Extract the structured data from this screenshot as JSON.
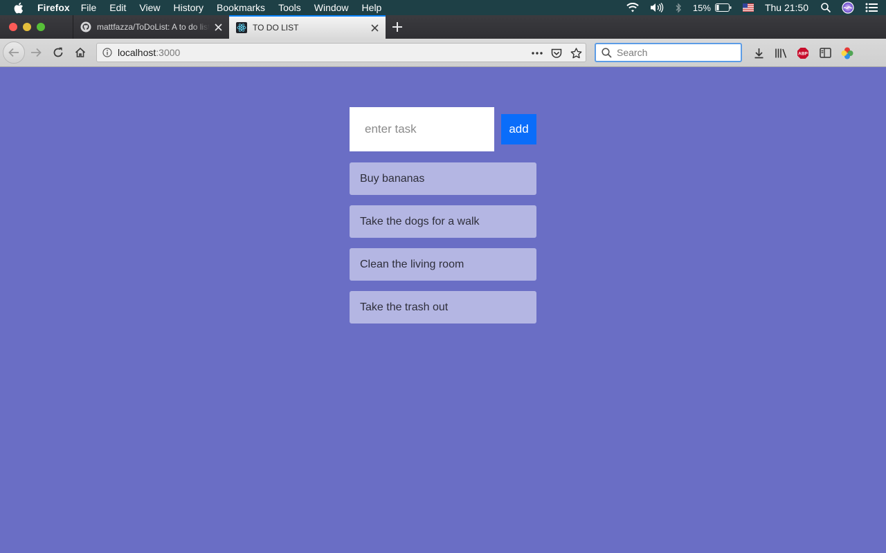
{
  "menubar": {
    "app_name": "Firefox",
    "items": [
      "File",
      "Edit",
      "View",
      "History",
      "Bookmarks",
      "Tools",
      "Window",
      "Help"
    ],
    "battery_percent": "15%",
    "clock": "Thu 21:50"
  },
  "tabs": [
    {
      "title": "mattfazza/ToDoList: A to do list",
      "icon": "github-icon",
      "active": false
    },
    {
      "title": "TO DO LIST",
      "icon": "react-icon",
      "active": true
    }
  ],
  "navbar": {
    "url_host": "localhost",
    "url_port": ":3000",
    "search_placeholder": "Search"
  },
  "app": {
    "input_placeholder": "enter task",
    "add_label": "add",
    "tasks": [
      "Buy bananas",
      "Take the dogs for a walk",
      "Clean the living room",
      "Take the trash out"
    ]
  },
  "colors": {
    "page_background": "#6a6ec5",
    "task_background": "#b4b6e3",
    "add_button": "#0a6dfa"
  }
}
